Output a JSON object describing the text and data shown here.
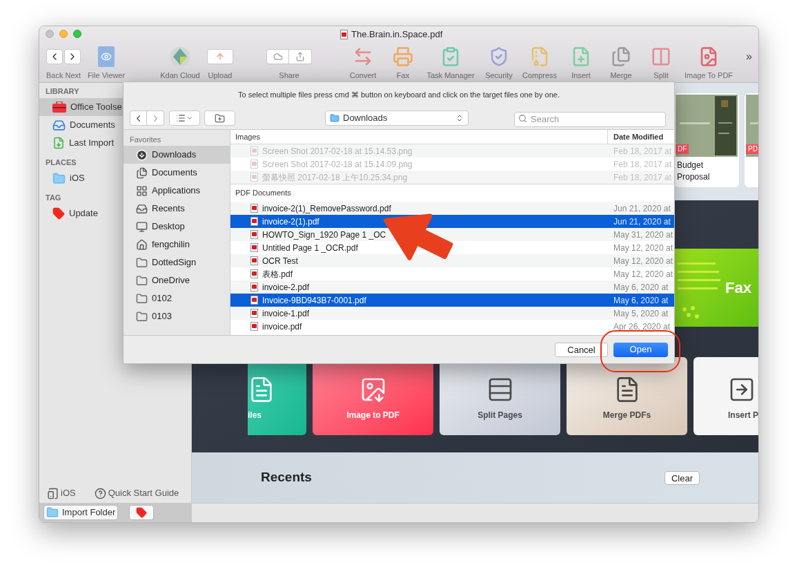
{
  "window": {
    "title": "The.Brain.in.Space.pdf"
  },
  "toolbar": {
    "nav_label": "Back Next",
    "overflow": "»",
    "items": [
      {
        "kind": "tool",
        "label": "File Viewer"
      },
      {
        "kind": "tool",
        "label": "Kdan Cloud"
      },
      {
        "kind": "button",
        "label": "Upload"
      },
      {
        "kind": "segmented",
        "label": "Share"
      },
      {
        "kind": "tool",
        "label": "Convert"
      },
      {
        "kind": "tool",
        "label": "Fax"
      },
      {
        "kind": "tool",
        "label": "Task Manager"
      },
      {
        "kind": "tool",
        "label": "Security"
      },
      {
        "kind": "tool",
        "label": "Compress"
      },
      {
        "kind": "tool",
        "label": "Insert"
      },
      {
        "kind": "tool",
        "label": "Merge"
      },
      {
        "kind": "tool",
        "label": "Split"
      },
      {
        "kind": "tool",
        "label": "Image To PDF"
      }
    ]
  },
  "sidebar": {
    "sections": [
      {
        "title": "LIBRARY",
        "items": [
          {
            "label": "Office Toolse",
            "selected": true
          },
          {
            "label": "Documents",
            "selected": false
          },
          {
            "label": "Last Import",
            "selected": false
          }
        ]
      },
      {
        "title": "PLACES",
        "items": [
          {
            "label": "iOS",
            "selected": false
          }
        ]
      },
      {
        "title": "TAG",
        "items": [
          {
            "label": "Update",
            "selected": false,
            "color": "#f5271d"
          }
        ]
      }
    ],
    "footer_links": [
      "iOS",
      "Quick Start Guide"
    ],
    "import_button": "Import Folder"
  },
  "documents": [
    {
      "badge": "DF",
      "title": "Budget Proposal"
    },
    {
      "badge": "PD"
    }
  ],
  "banner": {
    "title": "Fax"
  },
  "tool_cards": [
    {
      "label": "iles"
    },
    {
      "label": "Image to PDF"
    },
    {
      "label": "Split Pages"
    },
    {
      "label": "Merge PDFs"
    },
    {
      "label": "Insert P"
    }
  ],
  "recents": {
    "title": "Recents",
    "clear": "Clear"
  },
  "dialog": {
    "hint": "To select multiple files press cmd ⌘ button on keyboard and click on the target files one by one.",
    "location": "Downloads",
    "search": {
      "placeholder": "Search"
    },
    "favorites_title": "Favorites",
    "favorites": [
      {
        "label": "Downloads",
        "selected": true
      },
      {
        "label": "Documents",
        "selected": false
      },
      {
        "label": "Applications",
        "selected": false
      },
      {
        "label": "Recents",
        "selected": false
      },
      {
        "label": "Desktop",
        "selected": false
      },
      {
        "label": "fengchilin",
        "selected": false
      },
      {
        "label": "DottedSign",
        "selected": false
      },
      {
        "label": "OneDrive",
        "selected": false
      },
      {
        "label": "0102",
        "selected": false
      },
      {
        "label": "0103",
        "selected": false
      }
    ],
    "columns": [
      "Images",
      "Date Modified"
    ],
    "groups": [
      {
        "rows": [
          {
            "name": "Screen Shot 2017-02-18 at 15.14.53.png",
            "date": "Feb 18, 2017 at",
            "selected": false,
            "disabled": true
          },
          {
            "name": "Screen Shot 2017-02-18 at 15.14.09.png",
            "date": "Feb 18, 2017 at",
            "selected": false,
            "disabled": true
          },
          {
            "name": "螢幕快照 2017-02-18 上午10.25.34.png",
            "date": "Feb 18, 2017 at",
            "selected": false,
            "disabled": true
          }
        ]
      },
      {
        "title": "PDF Documents",
        "rows": [
          {
            "name": "invoice-2(1)_RemovePassword.pdf",
            "date": "Jun 21, 2020 at",
            "selected": false,
            "disabled": false
          },
          {
            "name": "invoice-2(1).pdf",
            "date": "Jun 21, 2020 at",
            "selected": true,
            "disabled": false
          },
          {
            "name": "HOWTO_Sign_1920 Page 1 _OC",
            "date": "May 31, 2020 at",
            "selected": false,
            "disabled": false
          },
          {
            "name": "Untitled Page 1 _OCR.pdf",
            "date": "May 12, 2020 at",
            "selected": false,
            "disabled": false
          },
          {
            "name": "OCR Test",
            "date": "May 12, 2020 at",
            "selected": false,
            "disabled": false
          },
          {
            "name": "表格.pdf",
            "date": "May 12, 2020 at",
            "selected": false,
            "disabled": false
          },
          {
            "name": "invoice-2.pdf",
            "date": "May 6, 2020 at",
            "selected": false,
            "disabled": false
          },
          {
            "name": "Invoice-9BD943B7-0001.pdf",
            "date": "May 6, 2020 at",
            "selected": true,
            "disabled": false
          },
          {
            "name": "invoice-1.pdf",
            "date": "May 5, 2020 at",
            "selected": false,
            "disabled": false
          },
          {
            "name": "invoice.pdf",
            "date": "Apr 26, 2020 at",
            "selected": false,
            "disabled": false
          }
        ]
      }
    ],
    "buttons": {
      "cancel": "Cancel",
      "open": "Open"
    }
  }
}
